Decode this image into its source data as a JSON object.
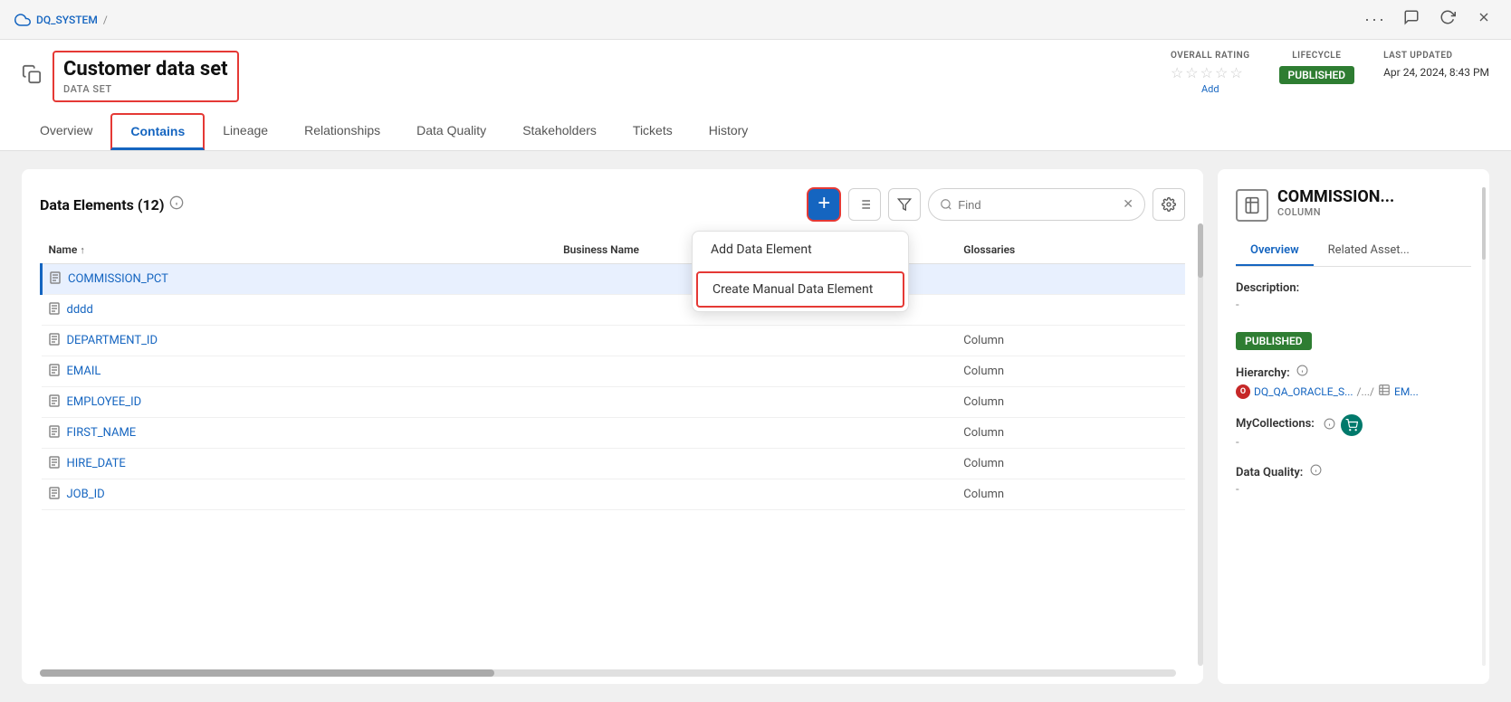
{
  "topbar": {
    "breadcrumb": "DQ_SYSTEM",
    "separator": "/",
    "more_label": "···",
    "comment_label": "💬",
    "refresh_label": "↻",
    "close_label": "✕"
  },
  "header": {
    "asset_title": "Customer data set",
    "asset_type": "DATA SET",
    "overall_rating_label": "OVERALL RATING",
    "add_label": "Add",
    "lifecycle_label": "LIFECYCLE",
    "published_label": "PUBLISHED",
    "last_updated_label": "LAST UPDATED",
    "last_updated_value": "Apr 24, 2024, 8:43 PM"
  },
  "tabs": [
    {
      "id": "overview",
      "label": "Overview",
      "active": false
    },
    {
      "id": "contains",
      "label": "Contains",
      "active": true
    },
    {
      "id": "lineage",
      "label": "Lineage",
      "active": false
    },
    {
      "id": "relationships",
      "label": "Relationships",
      "active": false
    },
    {
      "id": "data_quality",
      "label": "Data Quality",
      "active": false
    },
    {
      "id": "stakeholders",
      "label": "Stakeholders",
      "active": false
    },
    {
      "id": "tickets",
      "label": "Tickets",
      "active": false
    },
    {
      "id": "history",
      "label": "History",
      "active": false
    }
  ],
  "data_elements": {
    "title": "Data Elements",
    "count": 12,
    "search_placeholder": "Find",
    "columns": {
      "name": "Name",
      "business_name": "Business Name",
      "glossaries": "Glossaries"
    },
    "rows": [
      {
        "id": "commission_pct",
        "name": "COMMISSION_PCT",
        "business_name": "",
        "glossaries": "",
        "selected": true
      },
      {
        "id": "dddd",
        "name": "dddd",
        "business_name": "",
        "glossaries": ""
      },
      {
        "id": "department_id",
        "name": "DEPARTMENT_ID",
        "business_name": "",
        "glossaries": "Column"
      },
      {
        "id": "email",
        "name": "EMAIL",
        "business_name": "",
        "glossaries": "Column"
      },
      {
        "id": "employee_id",
        "name": "EMPLOYEE_ID",
        "business_name": "",
        "glossaries": "Column"
      },
      {
        "id": "first_name",
        "name": "FIRST_NAME",
        "business_name": "",
        "glossaries": "Column"
      },
      {
        "id": "hire_date",
        "name": "HIRE_DATE",
        "business_name": "",
        "glossaries": "Column"
      },
      {
        "id": "job_id",
        "name": "JOB_ID",
        "business_name": "",
        "glossaries": "Column"
      }
    ]
  },
  "dropdown": {
    "add_data_element": "Add Data Element",
    "create_manual": "Create Manual Data Element"
  },
  "right_panel": {
    "title": "COMMISSION...",
    "subtitle": "COLUMN",
    "overview_tab": "Overview",
    "related_asset_tab": "Related Asset...",
    "description_label": "Description:",
    "description_value": "-",
    "published_label": "PUBLISHED",
    "hierarchy_label": "Hierarchy:",
    "hierarchy_oracle": "DQ_QA_ORACLE_S...",
    "hierarchy_sep": "/.../",
    "hierarchy_table": "EM...",
    "mycollections_label": "MyCollections:",
    "data_quality_label": "Data Quality:"
  }
}
